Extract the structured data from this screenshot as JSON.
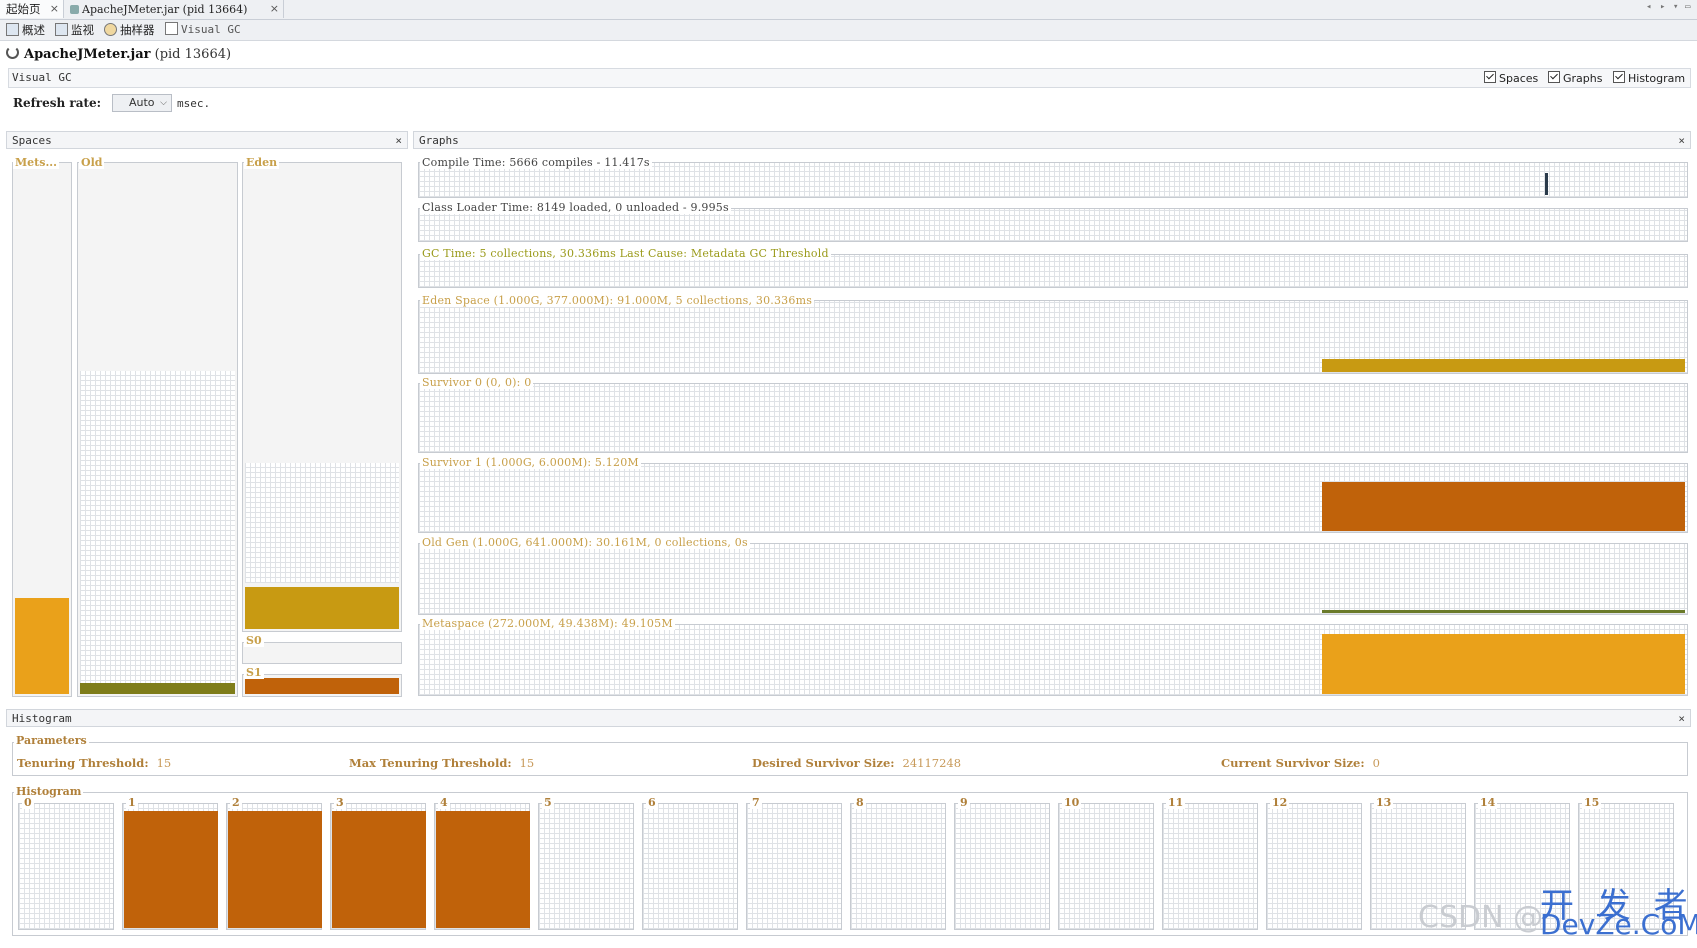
{
  "tabs": [
    {
      "label": "起始页",
      "close": "×"
    },
    {
      "label": "ApacheJMeter.jar (pid 13664)",
      "close": "×"
    }
  ],
  "toolbar": {
    "items": [
      {
        "label": "概述",
        "icon": "overview-icon"
      },
      {
        "label": "监视",
        "icon": "monitor-icon"
      },
      {
        "label": "抽样器",
        "icon": "sampler-icon"
      },
      {
        "label": "Visual GC",
        "icon": "visual-gc-icon"
      }
    ]
  },
  "app": {
    "title": "ApacheJMeter.jar",
    "pid": "(pid 13664)",
    "section": "Visual GC"
  },
  "view_toggles": [
    {
      "label": "Spaces",
      "checked": true
    },
    {
      "label": "Graphs",
      "checked": true
    },
    {
      "label": "Histogram",
      "checked": true
    }
  ],
  "refresh": {
    "label": "Refresh rate:",
    "value": "Auto",
    "unit": "msec."
  },
  "spaces": {
    "title": "Spaces",
    "close": "×",
    "metaspace_label": "Mets...",
    "old_label": "Old",
    "eden_label": "Eden",
    "s0_label": "S0",
    "s1_label": "S1",
    "colors": {
      "metaspace": "#eaa11a",
      "old": "#7f7d1a",
      "eden": "#c89a12",
      "s1": "#c0620a"
    },
    "levels": {
      "metaspace": 0.18,
      "old": 0.02,
      "eden": 0.09,
      "s0": 0.0,
      "s1": 0.85
    }
  },
  "graphs": {
    "title": "Graphs",
    "close": "×",
    "items": [
      {
        "label": "Compile Time: 5666 compiles - 11.417s"
      },
      {
        "label": "Class Loader Time: 8149 loaded, 0 unloaded - 9.995s"
      },
      {
        "label": "GC Time: 5 collections, 30.336ms Last Cause: Metadata GC Threshold"
      },
      {
        "label": "Eden Space (1.000G, 377.000M): 91.000M, 5 collections, 30.336ms"
      },
      {
        "label": "Survivor 0 (0, 0): 0"
      },
      {
        "label": "Survivor 1 (1.000G, 6.000M): 5.120M"
      },
      {
        "label": "Old Gen (1.000G, 641.000M): 30.161M, 0 collections, 0s"
      },
      {
        "label": "Metaspace (272.000M, 49.438M): 49.105M"
      }
    ]
  },
  "histogram": {
    "title": "Histogram",
    "close": "×",
    "params_title": "Parameters",
    "params": [
      {
        "label": "Tenuring Threshold:",
        "value": "15"
      },
      {
        "label": "Max Tenuring Threshold:",
        "value": "15"
      },
      {
        "label": "Desired Survivor Size:",
        "value": "24117248"
      },
      {
        "label": "Current Survivor Size:",
        "value": "0"
      }
    ],
    "hist_title": "Histogram",
    "bins": [
      "0",
      "1",
      "2",
      "3",
      "4",
      "5",
      "6",
      "7",
      "8",
      "9",
      "10",
      "11",
      "12",
      "13",
      "14",
      "15"
    ],
    "bin_levels": [
      0,
      1,
      1,
      1,
      1,
      0,
      0,
      0,
      0,
      0,
      0,
      0,
      0,
      0,
      0,
      0
    ],
    "bar_color": "#c0620a"
  },
  "watermark": {
    "csdn": "CSDN @",
    "brand_cn": "开 发 者",
    "brand_en": "DevZe.CoM"
  }
}
